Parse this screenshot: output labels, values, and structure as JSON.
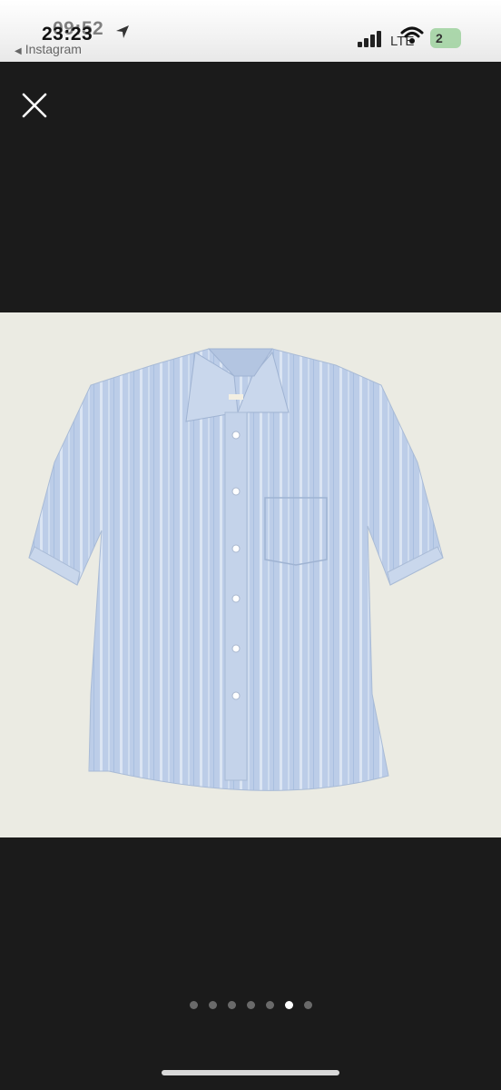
{
  "status_bar": {
    "time_overlay": "09:52",
    "time": "23:23",
    "back_app": "Instagram",
    "carrier": "LTE",
    "notification_count": "2",
    "location_icon": "location-arrow-icon",
    "signal_icon": "signal-bars-icon",
    "wifi_icon": "wifi-icon",
    "battery_icon": "battery-icon"
  },
  "viewer": {
    "close_icon": "close-icon",
    "image_description_icon": "product-photo",
    "page_indicator": {
      "count": 7,
      "active_index": 5
    }
  },
  "colors": {
    "background": "#1b1b1b",
    "photo_backdrop": "#ebebe3",
    "shirt": "#b9cbe6",
    "dot_inactive": "#6a6a6a",
    "dot_active": "#ffffff"
  }
}
